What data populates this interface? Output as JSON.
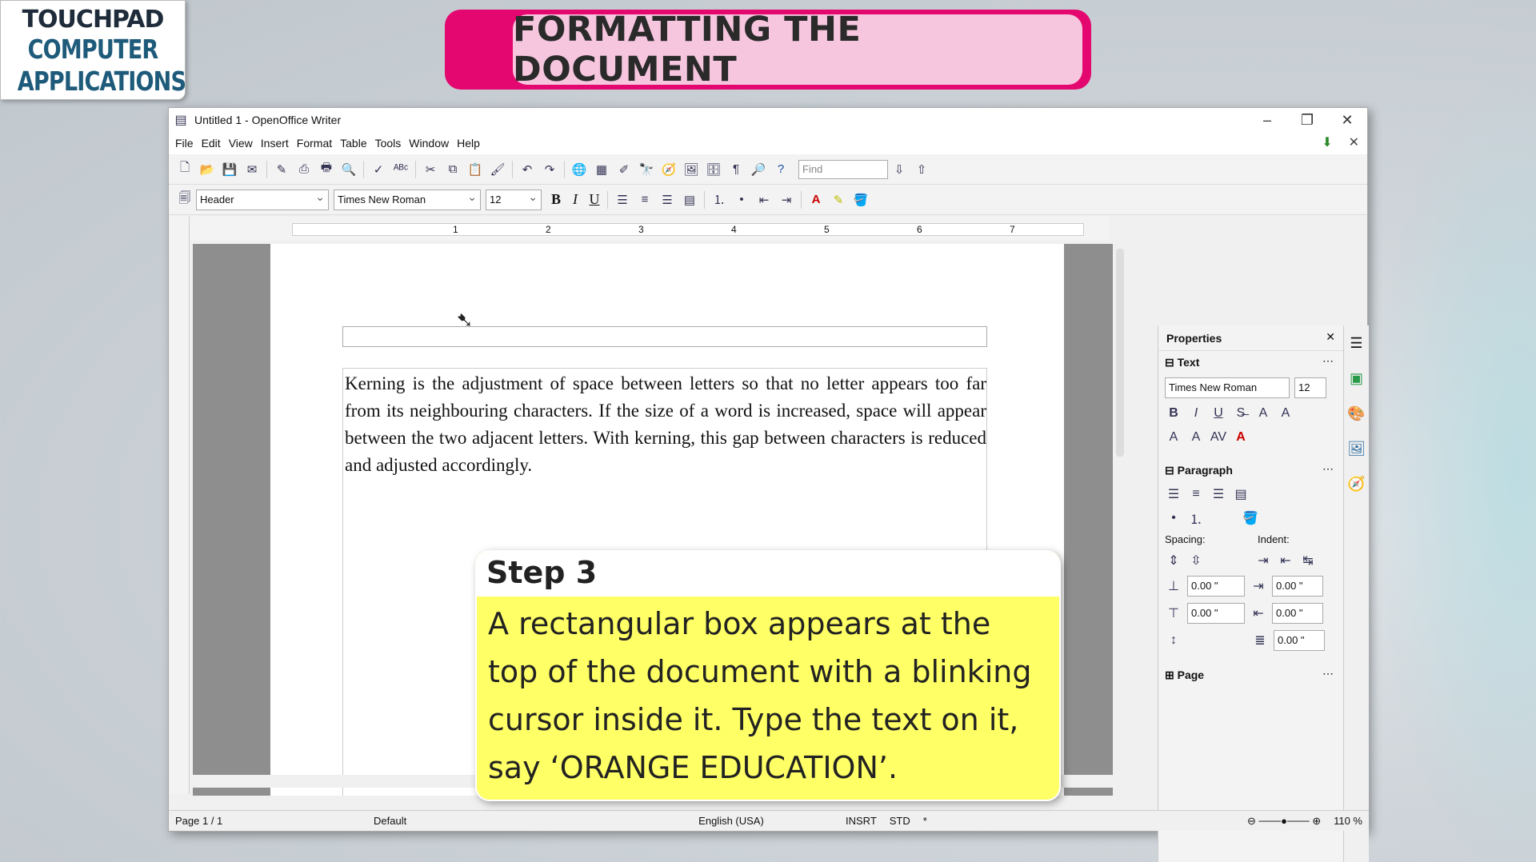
{
  "logo": {
    "line1": "TOUCHPAD",
    "line2": "COMPUTER",
    "line3": "APPLICATIONS"
  },
  "banner": {
    "title": "FORMATTING THE DOCUMENT"
  },
  "window": {
    "title": "Untitled 1 - OpenOffice Writer",
    "menu": [
      "File",
      "Edit",
      "View",
      "Insert",
      "Format",
      "Table",
      "Tools",
      "Window",
      "Help"
    ],
    "find_placeholder": "Find",
    "style_value": "Header",
    "font_value": "Times New Roman",
    "size_value": "12"
  },
  "ruler": {
    "marks": [
      "1",
      "2",
      "3",
      "4",
      "5",
      "6",
      "7"
    ]
  },
  "document": {
    "paragraph": "Kerning is the adjustment of space between letters so that no letter appears too far from its neighbouring characters. If the size of a word is increased, space will appear between the two adjacent letters. With kerning, this gap between characters is reduced and adjusted accordingly."
  },
  "sidebar": {
    "title": "Properties",
    "text_section": "Text",
    "font": "Times New Roman",
    "size": "12",
    "paragraph_section": "Paragraph",
    "spacing_label": "Spacing:",
    "indent_label": "Indent:",
    "val": "0.00 \"",
    "page_section": "Page"
  },
  "status": {
    "page": "Page 1 / 1",
    "style": "Default",
    "lang": "English (USA)",
    "mode": "INSRT",
    "sel": "STD",
    "mod": "*",
    "zoom": "110 %"
  },
  "step": {
    "title": "Step 3",
    "body": "A rectangular box appears at the top of the document with a blinking cursor inside it. Type the text on it, say ‘ORANGE EDUCATION’."
  }
}
